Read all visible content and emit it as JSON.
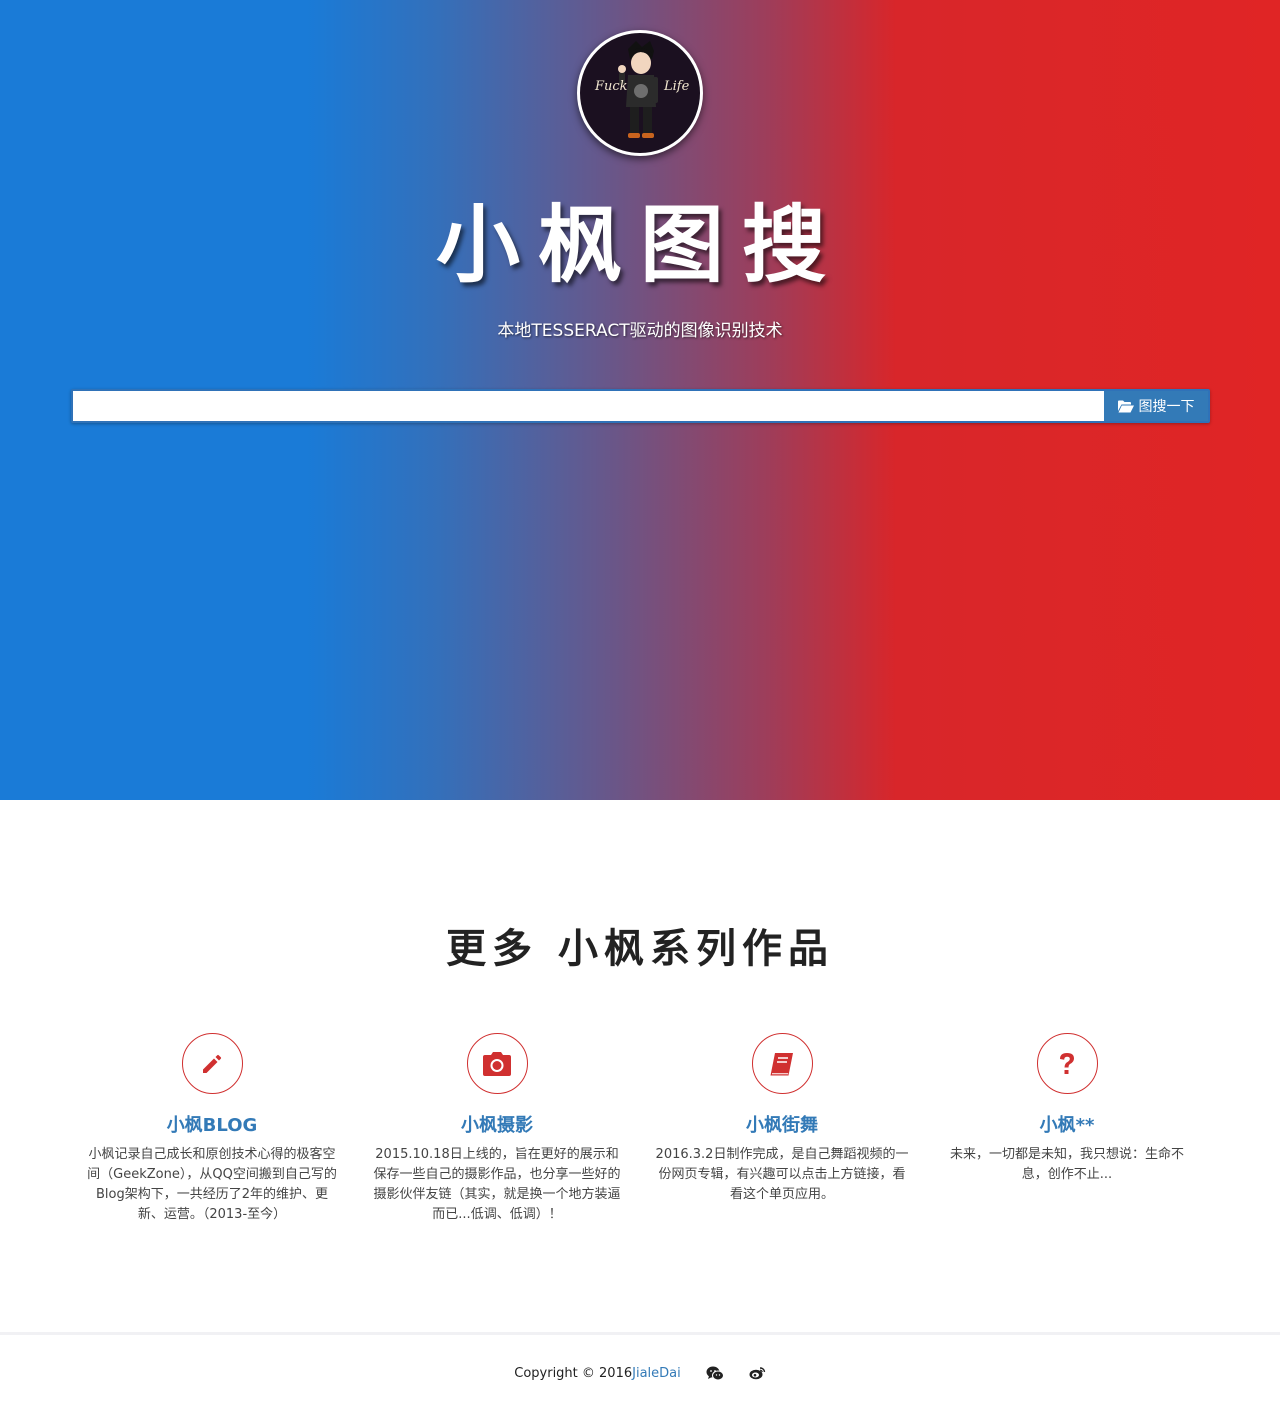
{
  "hero": {
    "avatar_text_left": "Fuck",
    "avatar_text_right": "Life",
    "title": "小枫图搜",
    "subtitle": "本地TESSERACT驱动的图像识别技术"
  },
  "search": {
    "value": "",
    "placeholder": "",
    "button_label": "图搜一下",
    "button_icon": "folder-open-icon"
  },
  "works": {
    "heading": "更多 小枫系列作品",
    "items": [
      {
        "title": "小枫BLOG",
        "icon": "pencil-icon",
        "desc": "小枫记录自己成长和原创技术心得的极客空间（GeekZone），从QQ空间搬到自己写的Blog架构下，一共经历了2年的维护、更新、运营。（2013-至今）"
      },
      {
        "title": "小枫摄影",
        "icon": "camera-icon",
        "desc": "2015.10.18日上线的，旨在更好的展示和保存一些自己的摄影作品，也分享一些好的摄影伙伴友链（其实，就是换一个地方装逼而已...低调、低调）！"
      },
      {
        "title": "小枫街舞",
        "icon": "book-icon",
        "desc": "2016.3.2日制作完成，是自己舞蹈视频的一份网页专辑，有兴趣可以点击上方链接，看看这个单页应用。"
      },
      {
        "title": "小枫**",
        "icon": "question-icon",
        "desc": "未来，一切都是未知，我只想说：生命不息，创作不止..."
      }
    ]
  },
  "footer": {
    "copyright": "Copyright © 2016 ",
    "author": "JialeDai",
    "icons": [
      "wechat-icon",
      "weibo-icon"
    ]
  },
  "colors": {
    "gradient_left": "#1a7bd7",
    "gradient_right": "#e02525",
    "accent": "#337ab7",
    "icon_red": "#d03030"
  }
}
